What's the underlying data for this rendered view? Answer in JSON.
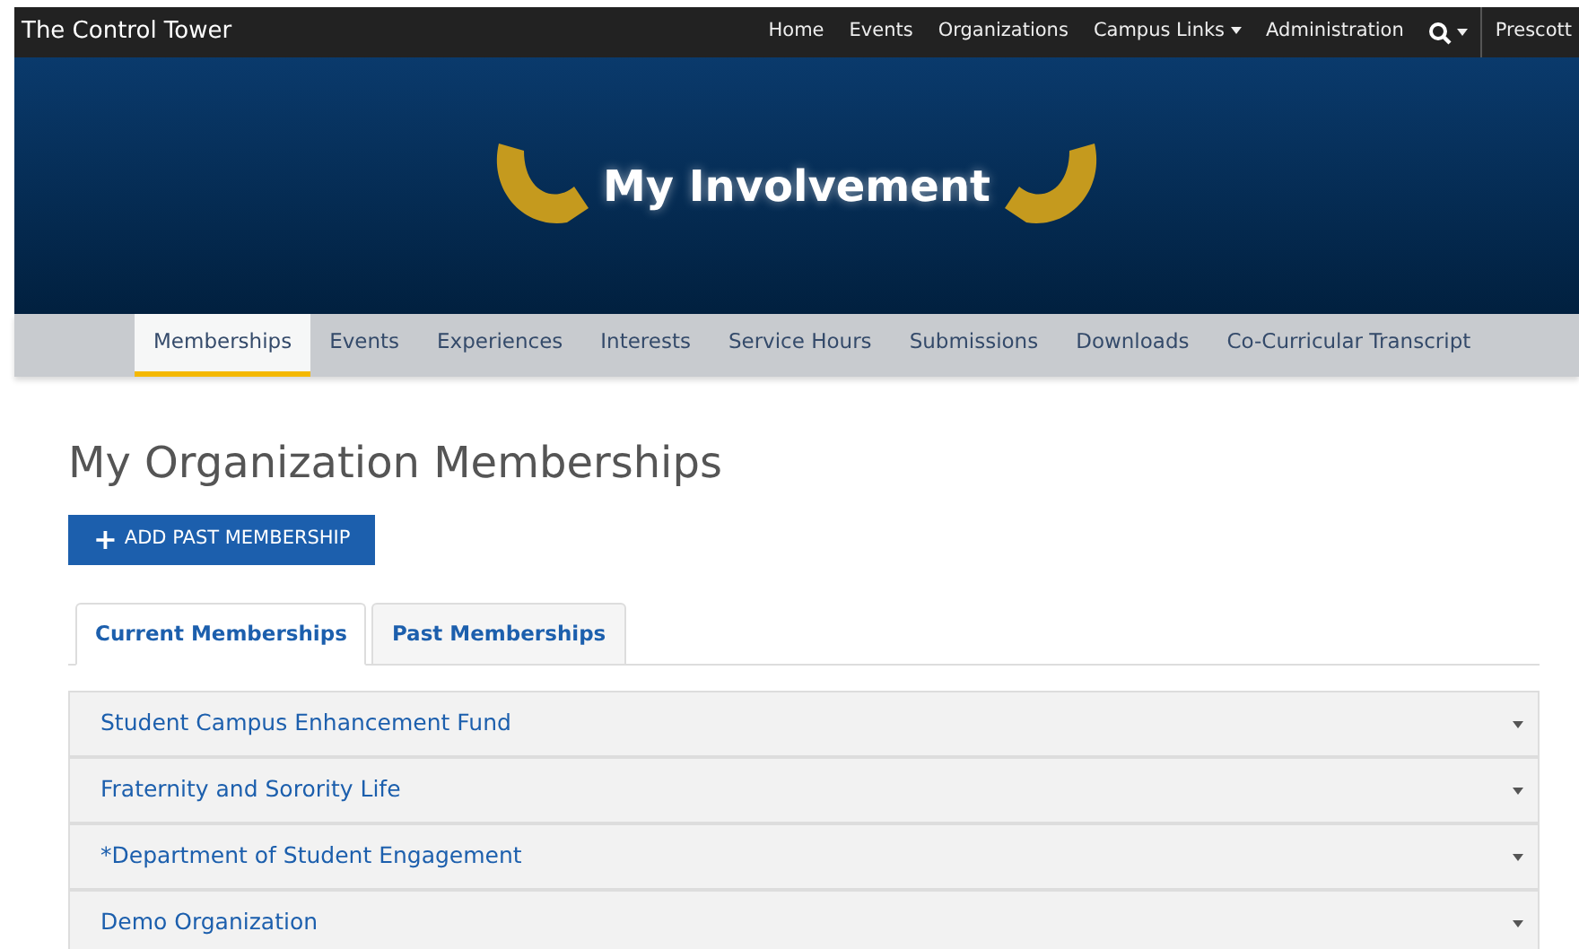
{
  "brand": "The Control Tower",
  "top_nav": [
    {
      "label": "Home",
      "dropdown": false
    },
    {
      "label": "Events",
      "dropdown": false
    },
    {
      "label": "Organizations",
      "dropdown": false
    },
    {
      "label": "Campus Links",
      "dropdown": true
    },
    {
      "label": "Administration",
      "dropdown": false
    }
  ],
  "search": {
    "dropdown": true
  },
  "campus": "Prescott",
  "banner": {
    "title": "My Involvement"
  },
  "sub_nav": [
    {
      "label": "Memberships",
      "selected": true
    },
    {
      "label": "Events",
      "selected": false
    },
    {
      "label": "Experiences",
      "selected": false
    },
    {
      "label": "Interests",
      "selected": false
    },
    {
      "label": "Service Hours",
      "selected": false
    },
    {
      "label": "Submissions",
      "selected": false
    },
    {
      "label": "Downloads",
      "selected": false
    },
    {
      "label": "Co-Curricular Transcript",
      "selected": false
    }
  ],
  "heading": "My Organization Memberships",
  "add_button": {
    "icon": "+",
    "label": "ADD PAST MEMBERSHIP"
  },
  "tabs": [
    {
      "label": "Current Memberships",
      "selected": true
    },
    {
      "label": "Past Memberships",
      "selected": false
    }
  ],
  "memberships": [
    {
      "name": "Student Campus Enhancement Fund",
      "expanded": false
    },
    {
      "name": "Fraternity and Sorority Life",
      "expanded": false
    },
    {
      "name": "*Department of Student Engagement",
      "expanded": false
    },
    {
      "name": "Demo Organization",
      "expanded": false
    }
  ]
}
